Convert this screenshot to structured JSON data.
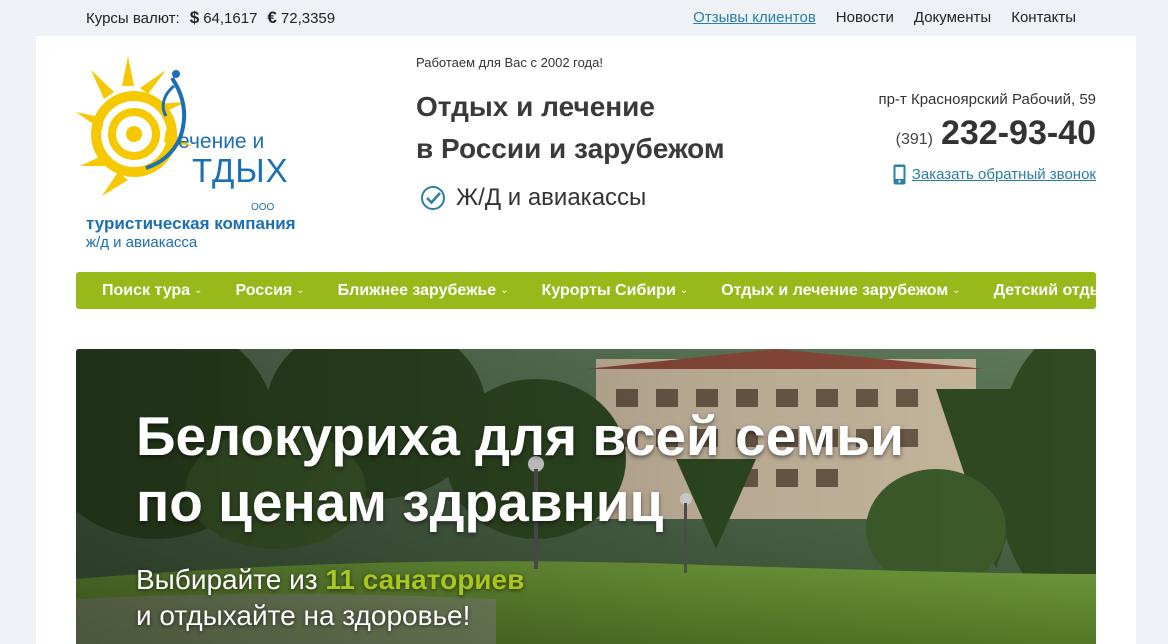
{
  "topbar": {
    "rates_label": "Курсы валют:",
    "usd_symbol": "$",
    "usd_value": "64,1617",
    "eur_symbol": "€",
    "eur_value": "72,3359",
    "links": [
      "Отзывы клиентов",
      "Новости",
      "Документы",
      "Контакты"
    ]
  },
  "logo": {
    "line1": "ечение и",
    "line2": "ТДЫХ",
    "ooo": "ООО",
    "line3": "туристическая компания",
    "line4": "ж/д и авиакасса"
  },
  "header": {
    "since": "Работаем для Вас с 2002 года!",
    "headline_1": "Отдых и лечение",
    "headline_2": "в России и зарубежом",
    "feature": "Ж/Д и авиакассы",
    "address": "пр-т Красноярский Рабочий, 59",
    "phone_code": "(391)",
    "phone_number": "232-93-40",
    "callback": "Заказать обратный звонок"
  },
  "nav": {
    "items": [
      "Поиск тура",
      "Россия",
      "Ближнее зарубежье",
      "Курорты Сибири",
      "Отдых и лечение зарубежом",
      "Детский отдых"
    ]
  },
  "banner": {
    "title_1": "Белокуриха для всей семьи",
    "title_2": "по ценам здравниц",
    "sub_prefix": "Выбирайте из ",
    "sub_highlight": "11 санаториев",
    "sub_line2": "и отдыхайте на здоровье!"
  },
  "colors": {
    "nav_bg": "#97b91a",
    "link": "#2a7fa8",
    "logo_blue": "#1b6fb5",
    "logo_yellow": "#f5c800",
    "highlight": "#a9c51e"
  }
}
